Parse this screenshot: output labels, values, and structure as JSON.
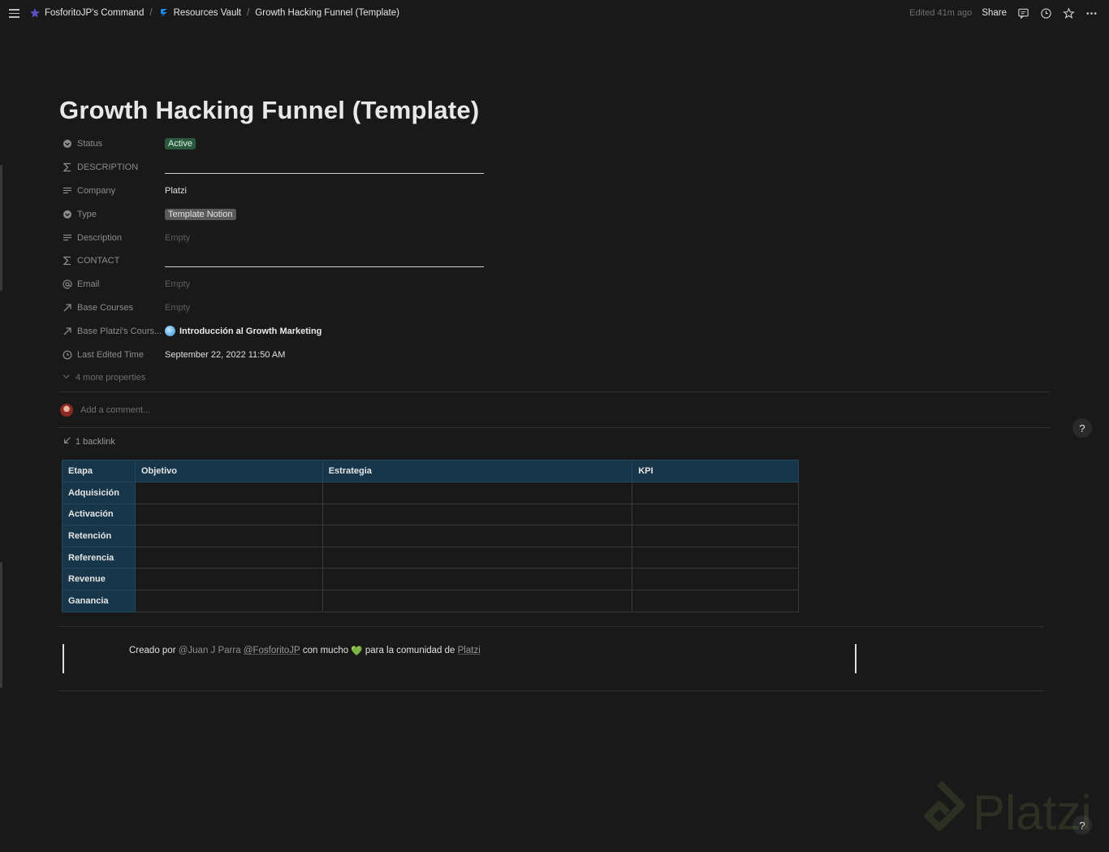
{
  "breadcrumb": [
    {
      "label": "FosforitoJP's Command",
      "icon": "workspace-icon"
    },
    {
      "label": "Resources Vault",
      "icon": "database-icon"
    },
    {
      "label": "Growth Hacking Funnel (Template)"
    }
  ],
  "breadcrumb_sep": "/",
  "topbar": {
    "edited": "Edited 41m ago",
    "share": "Share"
  },
  "page": {
    "title": "Growth Hacking Funnel (Template)"
  },
  "properties": {
    "status": {
      "name": "Status",
      "value": "Active"
    },
    "description_header": {
      "name": "DESCRIPTION"
    },
    "company": {
      "name": "Company",
      "value": "Platzi"
    },
    "type": {
      "name": "Type",
      "value": "Template Notion"
    },
    "description": {
      "name": "Description",
      "value": "Empty"
    },
    "contact_header": {
      "name": "CONTACT"
    },
    "email": {
      "name": "Email",
      "value": "Empty"
    },
    "base_courses": {
      "name": "Base Courses",
      "value": "Empty"
    },
    "base_platzi": {
      "name": "Base Platzi's Cours...",
      "value": "Introducción al Growth Marketing"
    },
    "last_edited": {
      "name": "Last Edited Time",
      "value": "September 22, 2022 11:50 AM"
    },
    "more": "4 more properties"
  },
  "comment": {
    "placeholder": "Add a comment..."
  },
  "backlink": "1 backlink",
  "table": {
    "headers": [
      "Etapa",
      "Objetivo",
      "Estrategia",
      "KPI"
    ],
    "rows": [
      "Adquisición",
      "Activación",
      "Retención",
      "Referencia",
      "Revenue",
      "Ganancia"
    ]
  },
  "credit": {
    "prefix": "Creado por ",
    "author": "@Juan J Parra",
    "mention": "@FosforitoJP",
    "middle": " con mucho ",
    "heart": "💚",
    "suffix": " para la comunidad de ",
    "link": "Platzi"
  },
  "help": "?",
  "watermark": "Platzi",
  "colors": {
    "background": "#191919",
    "status_tag": "#2b593f",
    "type_tag": "#5a5a5a",
    "table_header": "#18364a"
  }
}
